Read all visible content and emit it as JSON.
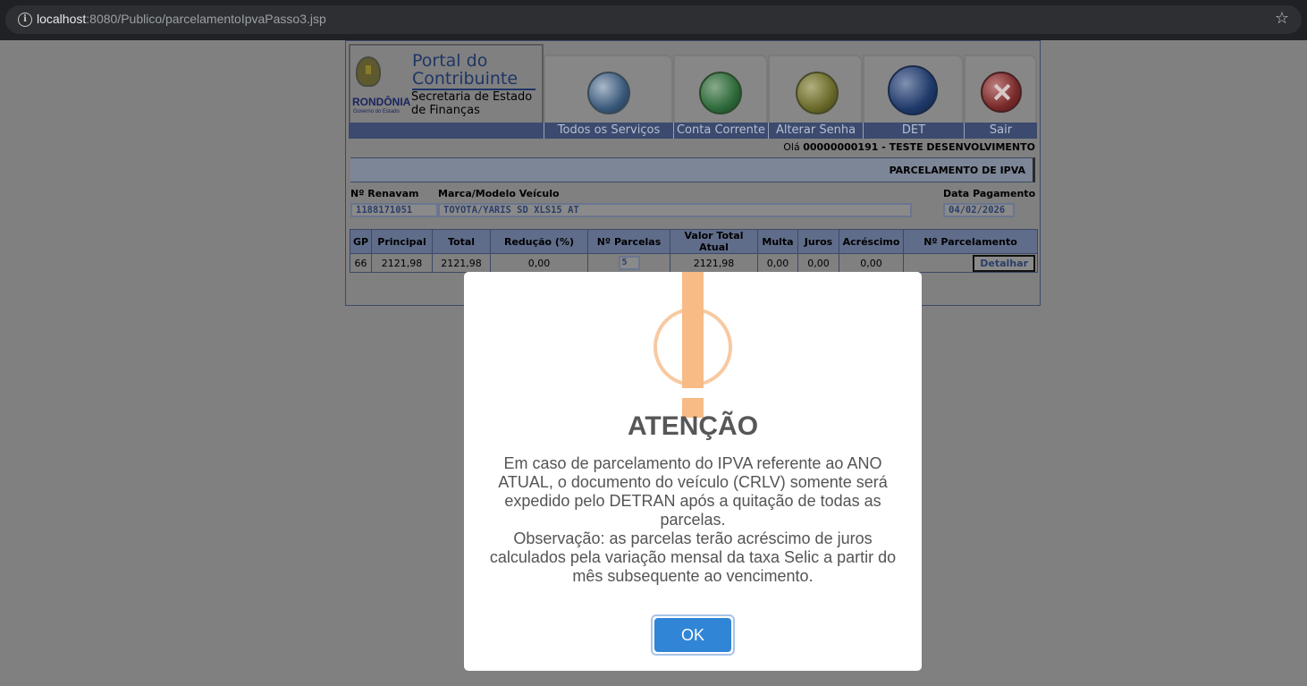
{
  "browser": {
    "url_host": "localhost",
    "url_rest": ":8080/Publico/parcelamentoIpvaPasso3.jsp"
  },
  "header": {
    "portal_line1": "Portal do",
    "portal_line2": "Contribuinte",
    "secretaria_line1": "Secretaria de Estado",
    "secretaria_line2": "de Finanças",
    "state": "RONDÔNIA",
    "gov": "Governo do Estado",
    "nav": [
      {
        "label": "Todos os Serviços",
        "icon": "globe-computer-icon"
      },
      {
        "label": "Conta Corrente",
        "icon": "magnifier-document-icon"
      },
      {
        "label": "Alterar Senha",
        "icon": "key-icon"
      },
      {
        "label": "DET",
        "icon": "bell-icon"
      },
      {
        "label": "Sair",
        "icon": "close-icon"
      }
    ]
  },
  "user": {
    "greeting": "Olá",
    "name": "00000000191 - TESTE DESENVOLVIMENTO"
  },
  "section_title": "PARCELAMENTO DE IPVA",
  "form": {
    "renavam_label": "Nº Renavam",
    "renavam_value": "1188171051",
    "modelo_label": "Marca/Modelo Veículo",
    "modelo_value": "TOYOTA/YARIS SD XLS15 AT",
    "data_label": "Data Pagamento",
    "data_value": "04/02/2026"
  },
  "table": {
    "headers": [
      "GP",
      "Principal",
      "Total",
      "Redução (%)",
      "Nº Parcelas",
      "Valor Total Atual",
      "Multa",
      "Juros",
      "Acréscimo",
      "Nº Parcelamento"
    ],
    "row": {
      "gp": "66",
      "principal": "2121,98",
      "total": "2121,98",
      "reducao": "0,00",
      "parcelas": "5",
      "valor_total": "2121,98",
      "multa": "0,00",
      "juros": "0,00",
      "acrescimo": "0,00",
      "action": "Detalhar"
    }
  },
  "modal": {
    "title": "ATENÇÃO",
    "line1": "Em caso de parcelamento do IPVA referente ao ANO ATUAL, o documento do veículo (CRLV) somente será expedido pelo DETRAN após a quitação de todas as parcelas.",
    "line2": "Observação: as parcelas terão acréscimo de juros calculados pela variação mensal da taxa Selic a partir do mês subsequente ao vencimento.",
    "ok_label": "OK",
    "icon": "warning-icon",
    "accent": "#f8bb86",
    "button_color": "#3085d6"
  }
}
